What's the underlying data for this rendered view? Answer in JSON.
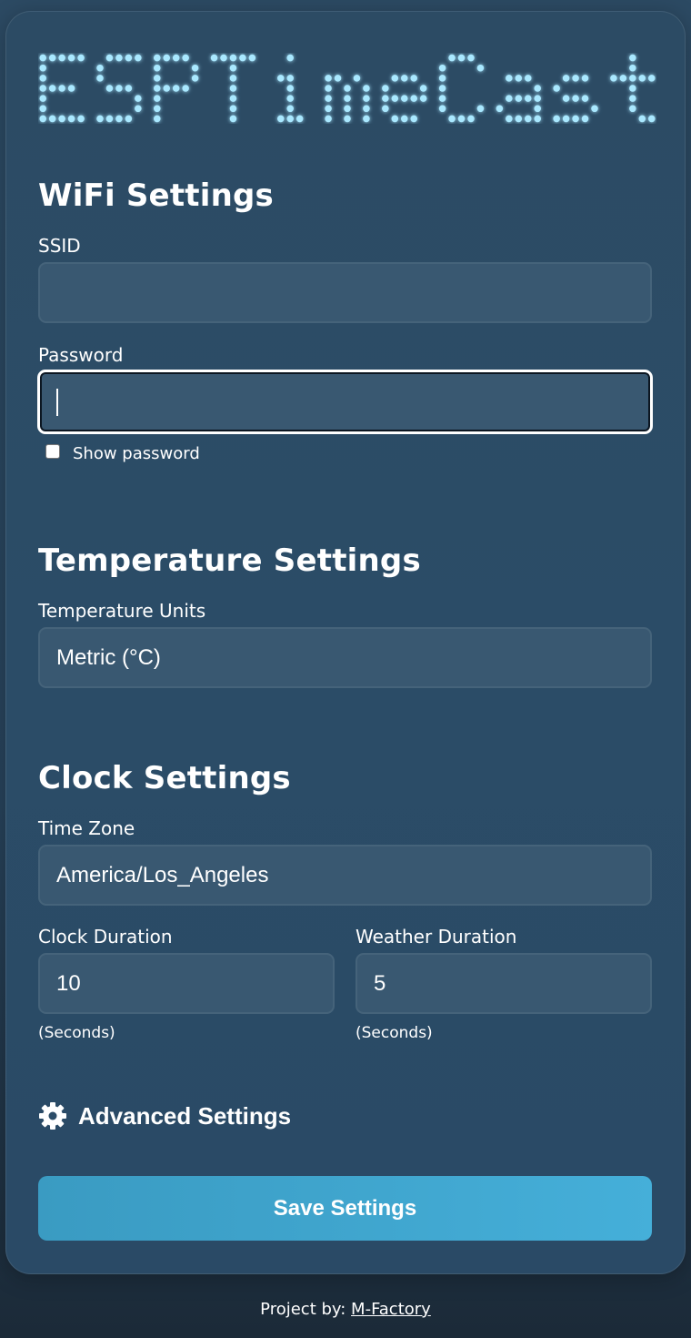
{
  "logo": {
    "text": "ESPTimeCast",
    "color": "#a9e8ff"
  },
  "wifi": {
    "title": "WiFi Settings",
    "ssid_label": "SSID",
    "ssid_value": "",
    "password_label": "Password",
    "password_value": "",
    "show_password_label": "Show password",
    "show_password_checked": false
  },
  "temperature": {
    "title": "Temperature Settings",
    "units_label": "Temperature Units",
    "units_value": "Metric (°C)"
  },
  "clock": {
    "title": "Clock Settings",
    "timezone_label": "Time Zone",
    "timezone_value": "America/Los_Angeles",
    "clock_duration_label": "Clock Duration",
    "clock_duration_value": "10",
    "clock_duration_hint": "(Seconds)",
    "weather_duration_label": "Weather Duration",
    "weather_duration_value": "5",
    "weather_duration_hint": "(Seconds)"
  },
  "advanced": {
    "label": "Advanced Settings",
    "icon": "gear-icon"
  },
  "save_button_label": "Save Settings",
  "footer": {
    "prefix": "Project by: ",
    "link_text": "M-Factory"
  },
  "colors": {
    "accent": "#45afd9",
    "field_bg": "#395871"
  }
}
